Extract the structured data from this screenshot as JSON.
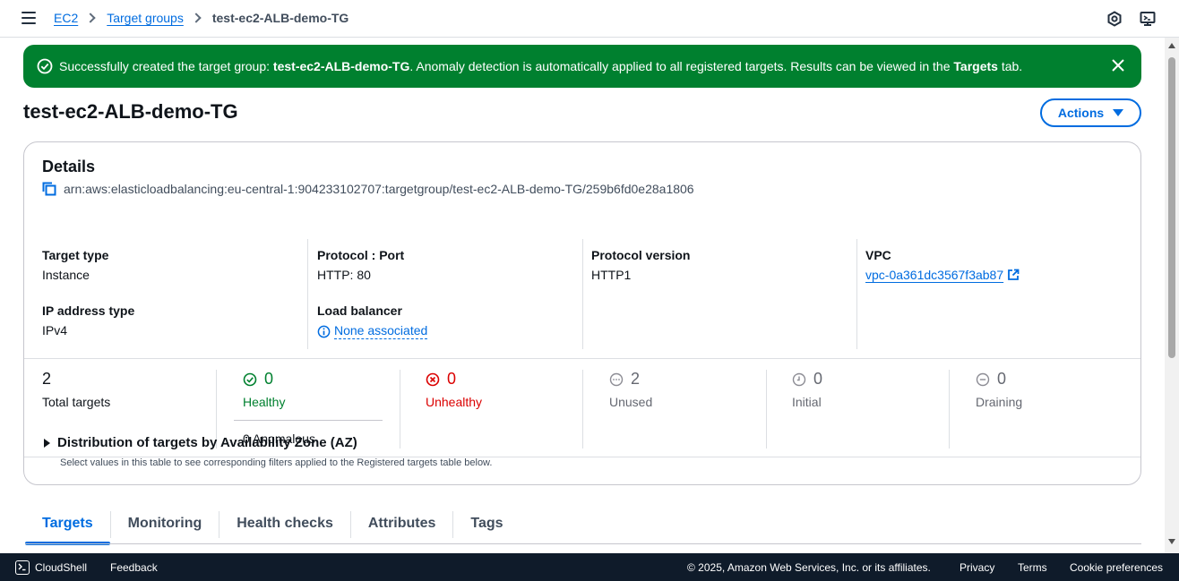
{
  "breadcrumb": {
    "items": [
      "EC2",
      "Target groups"
    ],
    "current": "test-ec2-ALB-demo-TG"
  },
  "flash": {
    "text_before": "Successfully created the target group: ",
    "tg_name": "test-ec2-ALB-demo-TG",
    "text_middle": ". Anomaly detection is automatically applied to all registered targets. Results can be viewed in the ",
    "targets_word": "Targets",
    "text_after": " tab."
  },
  "page": {
    "title": "test-ec2-ALB-demo-TG",
    "actions_label": "Actions"
  },
  "details": {
    "heading": "Details",
    "arn": "arn:aws:elasticloadbalancing:eu-central-1:904233102707:targetgroup/test-ec2-ALB-demo-TG/259b6fd0e28a1806",
    "target_type_label": "Target type",
    "target_type": "Instance",
    "protocol_port_label": "Protocol : Port",
    "protocol_port": "HTTP: 80",
    "protocol_version_label": "Protocol version",
    "protocol_version": "HTTP1",
    "vpc_label": "VPC",
    "vpc": "vpc-0a361dc3567f3ab87",
    "ip_type_label": "IP address type",
    "ip_type": "IPv4",
    "lb_label": "Load balancer",
    "lb": "None associated"
  },
  "stats": {
    "total": {
      "value": "2",
      "label": "Total targets"
    },
    "healthy": {
      "value": "0",
      "label": "Healthy",
      "anomalous": "0 Anomalous"
    },
    "unhealthy": {
      "value": "0",
      "label": "Unhealthy"
    },
    "unused": {
      "value": "2",
      "label": "Unused"
    },
    "initial": {
      "value": "0",
      "label": "Initial"
    },
    "draining": {
      "value": "0",
      "label": "Draining"
    }
  },
  "az": {
    "title": "Distribution of targets by Availability Zone (AZ)",
    "description": "Select values in this table to see corresponding filters applied to the Registered targets table below."
  },
  "tabs": [
    "Targets",
    "Monitoring",
    "Health checks",
    "Attributes",
    "Tags"
  ],
  "footer": {
    "cloudshell": "CloudShell",
    "feedback": "Feedback",
    "copyright": "© 2025, Amazon Web Services, Inc. or its affiliates.",
    "privacy": "Privacy",
    "terms": "Terms",
    "cookies": "Cookie preferences"
  },
  "colors": {
    "accent": "#006ce0",
    "success": "#00802f",
    "error": "#db0000",
    "footer_bg": "#0f1b2a"
  }
}
